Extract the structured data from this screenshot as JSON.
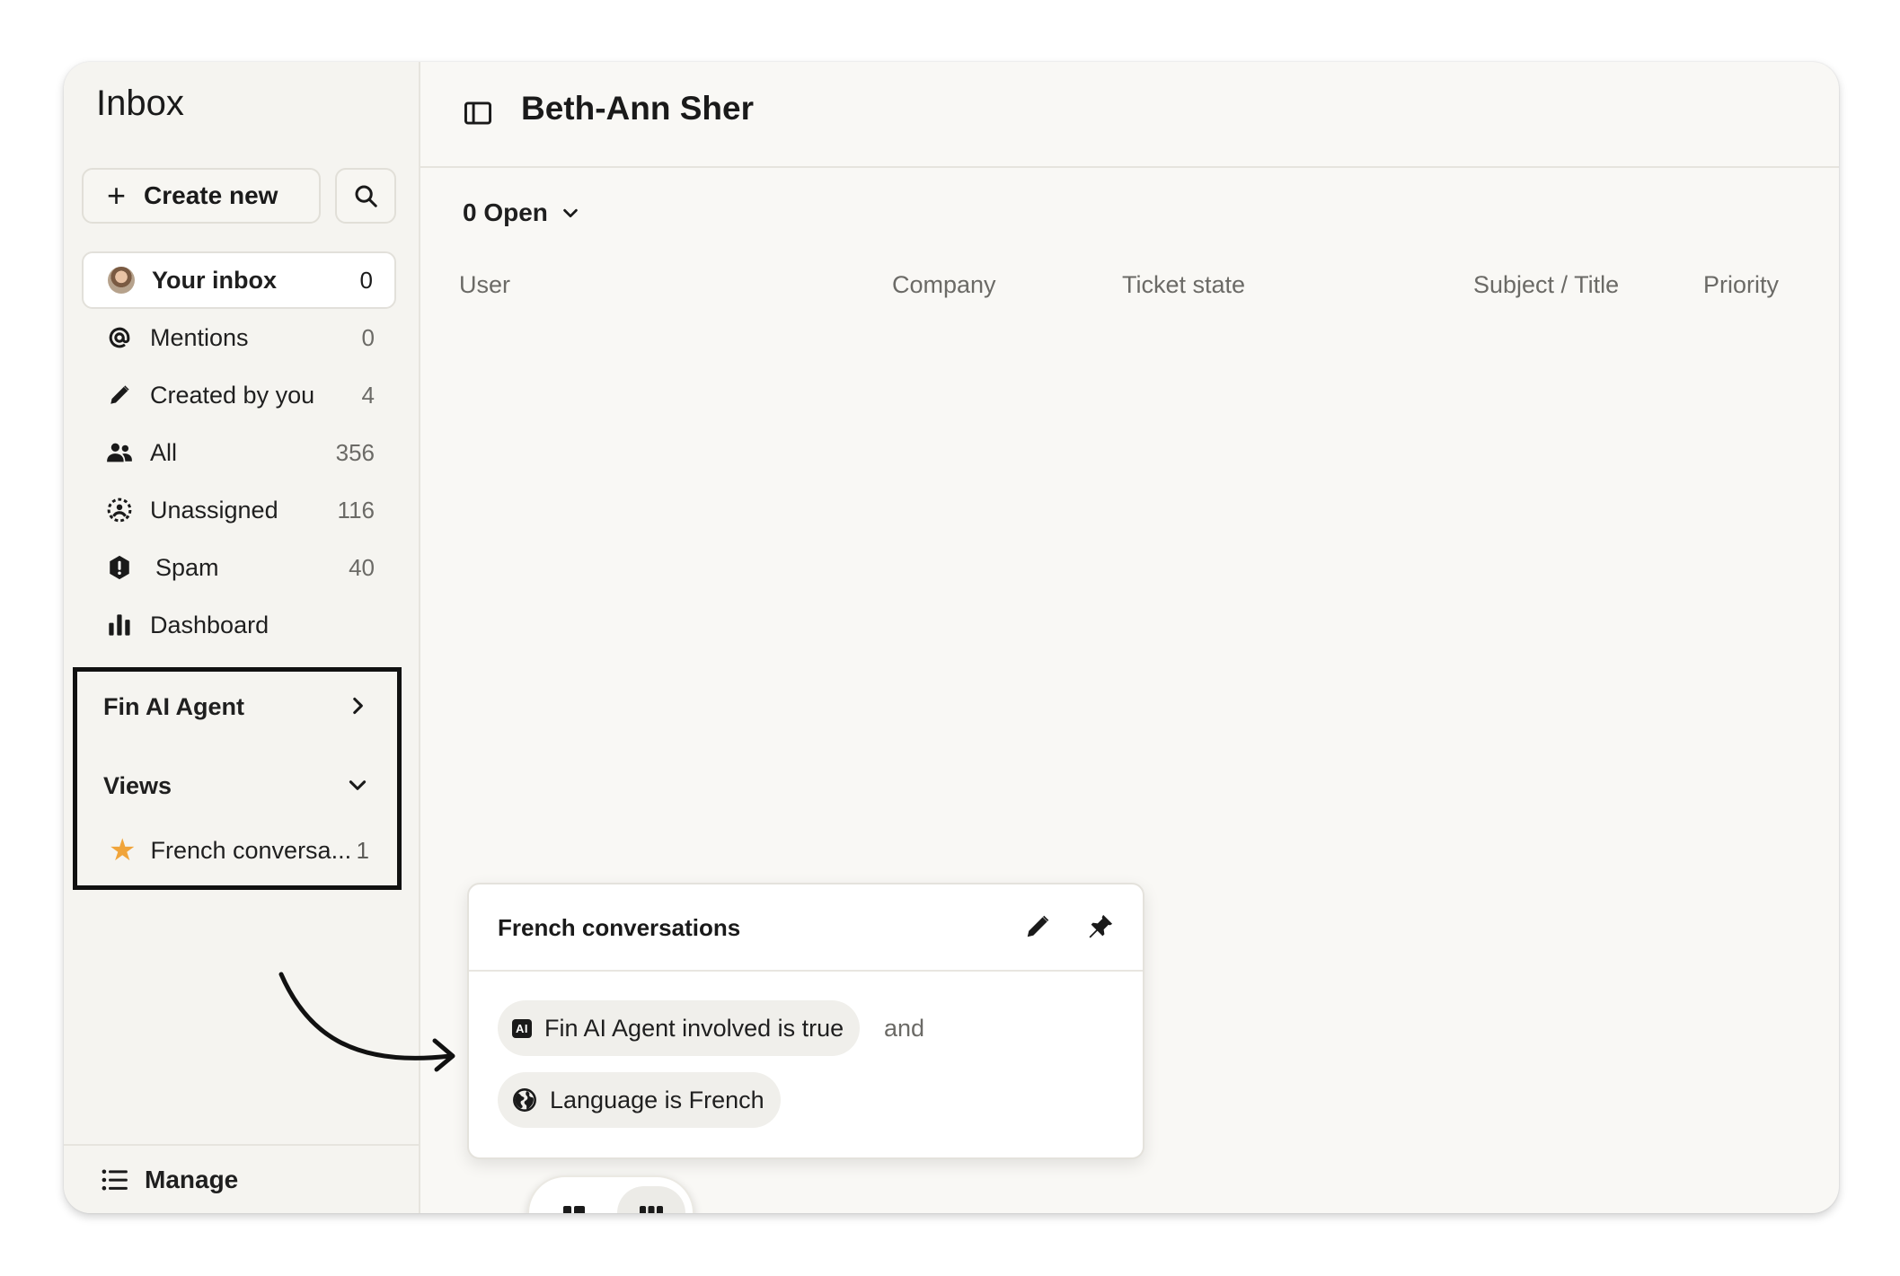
{
  "sidebar": {
    "title": "Inbox",
    "create_label": "Create new",
    "items": [
      {
        "label": "Your inbox",
        "count": "0",
        "icon": "avatar"
      },
      {
        "label": "Mentions",
        "count": "0",
        "icon": "at-icon"
      },
      {
        "label": "Created by you",
        "count": "4",
        "icon": "pencil-icon"
      },
      {
        "label": "All",
        "count": "356",
        "icon": "people-icon"
      },
      {
        "label": "Unassigned",
        "count": "116",
        "icon": "unassigned-icon"
      },
      {
        "label": "Spam",
        "count": "40",
        "icon": "shield-alert-icon"
      },
      {
        "label": "Dashboard",
        "count": "",
        "icon": "bar-chart-icon"
      }
    ],
    "fin_ai_agent_label": "Fin AI Agent",
    "views_label": "Views",
    "views": [
      {
        "label": "French conversa...",
        "count": "1",
        "icon": "star-icon"
      }
    ],
    "manage_label": "Manage"
  },
  "main": {
    "title": "Beth-Ann Sher",
    "open_filter": "0 Open",
    "columns": [
      "User",
      "Company",
      "Ticket state",
      "Subject / Title",
      "Priority"
    ]
  },
  "popover": {
    "title": "French conversations",
    "conditions": [
      {
        "badge": "AI",
        "label": "Fin AI Agent involved is true"
      },
      {
        "label": "Language is French",
        "icon": "globe-icon"
      }
    ],
    "joiner": "and"
  },
  "colors": {
    "background": "#f9f8f5",
    "sidebar": "#f5f4f0",
    "star": "#f0a43a",
    "highlight_border": "#111111"
  }
}
